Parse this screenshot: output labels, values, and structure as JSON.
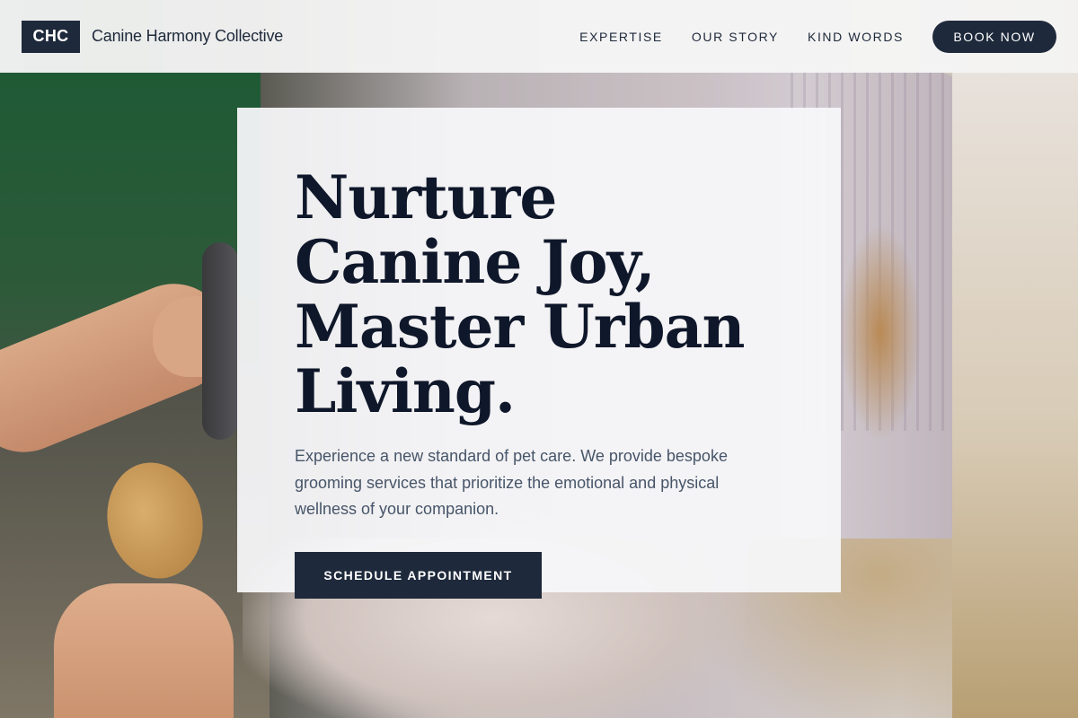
{
  "brand": {
    "logo_text": "CHC",
    "name": "Canine Harmony Collective"
  },
  "nav": {
    "links": [
      "EXPERTISE",
      "OUR STORY",
      "KIND WORDS"
    ],
    "cta_label": "BOOK NOW"
  },
  "hero": {
    "title": "Nurture Canine Joy, Master Urban Living.",
    "description": "Experience a new standard of pet care. We provide bespoke grooming services that prioritize the emotional and physical wellness of your companion.",
    "cta_label": "SCHEDULE APPOINTMENT"
  },
  "colors": {
    "primary": "#1e293b",
    "heading": "#0f172a",
    "body_text": "#475569",
    "header_bg": "#f6f6f6"
  }
}
